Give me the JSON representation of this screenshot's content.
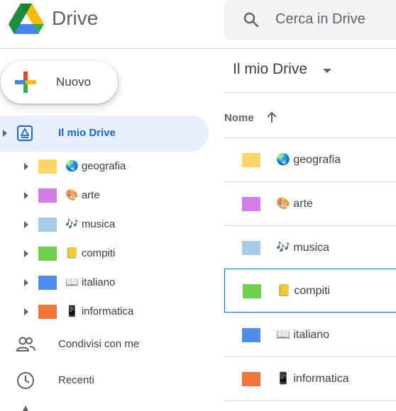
{
  "header": {
    "brand": "Drive",
    "search_placeholder": "Cerca in Drive"
  },
  "new_button": {
    "label": "Nuovo"
  },
  "sidebar": {
    "my_drive": {
      "label": "Il mio Drive"
    },
    "folders": [
      {
        "label": "🌏 geografia",
        "color": "#fdd663"
      },
      {
        "label": "🎨 arte",
        "color": "#d27de8"
      },
      {
        "label": "🎶 musica",
        "color": "#a8cbec"
      },
      {
        "label": "📒 compiti",
        "color": "#6dd150"
      },
      {
        "label": "📖 italiano",
        "color": "#4f8be9"
      },
      {
        "label": "📱 informatica",
        "color": "#f2763a"
      }
    ],
    "shared": {
      "label": "Condivisi con me",
      "icon": "people-icon"
    },
    "recent": {
      "label": "Recenti",
      "icon": "clock-icon"
    }
  },
  "main": {
    "title": "Il mio Drive",
    "column_header": "Nome",
    "sort": "ascending",
    "files": [
      {
        "label": "🌏 geografia",
        "color": "#fdd663",
        "selected": false
      },
      {
        "label": "🎨 arte",
        "color": "#d27de8",
        "selected": false
      },
      {
        "label": "🎶 musica",
        "color": "#a8cbec",
        "selected": false
      },
      {
        "label": "📒 compiti",
        "color": "#6dd150",
        "selected": true
      },
      {
        "label": "📖 italiano",
        "color": "#4f8be9",
        "selected": false
      },
      {
        "label": "📱 informatica",
        "color": "#f2763a",
        "selected": false
      }
    ]
  },
  "colors": {
    "accent": "#1967d2",
    "active_bg": "#e8f0fe",
    "selection_border": "#1a73e8"
  }
}
